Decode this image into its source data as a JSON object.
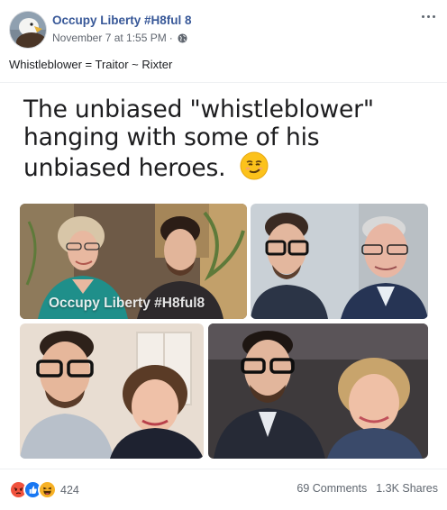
{
  "post": {
    "page_name": "Occupy Liberty #H8ful 8",
    "timestamp": "November 7 at 1:55 PM",
    "separator": "·",
    "privacy_icon": "globe-icon",
    "more_icon": "more-options-icon",
    "text": "Whistleblower = Traitor ~ Rixter"
  },
  "image": {
    "headline_lines": [
      "The unbiased \"whistleblower\"",
      "hanging with some of his",
      "unbiased heroes."
    ],
    "emoji": "smirking-face-emoji",
    "watermark": "Occupy Liberty #H8ful8"
  },
  "footer": {
    "reaction_icons": [
      "angry-reaction-icon",
      "like-reaction-icon",
      "haha-reaction-icon"
    ],
    "reaction_count": "424",
    "comments": "69 Comments",
    "shares": "1.3K Shares"
  },
  "colors": {
    "page_name": "#385898",
    "meta_text": "#616770",
    "like_blue": "#1877f2",
    "angry_orange": "#f0523d",
    "haha_yellow": "#f7b125"
  }
}
